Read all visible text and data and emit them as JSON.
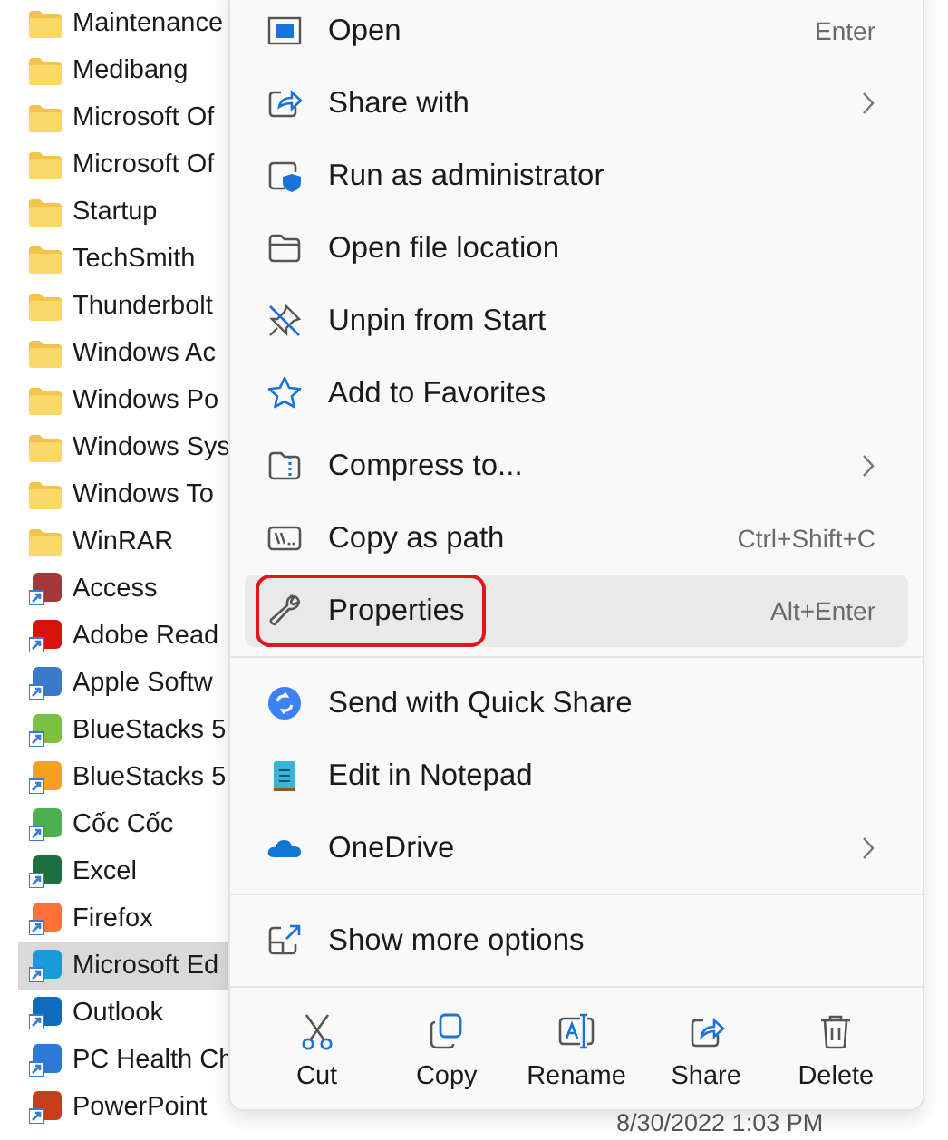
{
  "file_list": [
    {
      "name": "Maintenance",
      "kind": "folder",
      "selected": false
    },
    {
      "name": "Medibang",
      "kind": "folder",
      "selected": false
    },
    {
      "name": "Microsoft Of",
      "kind": "folder",
      "selected": false
    },
    {
      "name": "Microsoft Of",
      "kind": "folder",
      "selected": false
    },
    {
      "name": "Startup",
      "kind": "folder",
      "selected": false
    },
    {
      "name": "TechSmith",
      "kind": "folder",
      "selected": false
    },
    {
      "name": "Thunderbolt",
      "kind": "folder",
      "selected": false
    },
    {
      "name": "Windows Ac",
      "kind": "folder",
      "selected": false
    },
    {
      "name": "Windows Po",
      "kind": "folder",
      "selected": false
    },
    {
      "name": "Windows Sys",
      "kind": "folder",
      "selected": false
    },
    {
      "name": "Windows To",
      "kind": "folder",
      "selected": false
    },
    {
      "name": "WinRAR",
      "kind": "folder",
      "selected": false
    },
    {
      "name": "Access",
      "kind": "app",
      "color": "#a4373a",
      "selected": false
    },
    {
      "name": "Adobe Read",
      "kind": "app",
      "color": "#d7130c",
      "selected": false
    },
    {
      "name": "Apple Softw",
      "kind": "app",
      "color": "#3a78c9",
      "selected": false
    },
    {
      "name": "BlueStacks 5",
      "kind": "app",
      "color": "#7cc142",
      "selected": false
    },
    {
      "name": "BlueStacks 5",
      "kind": "app",
      "color": "#f4a020",
      "selected": false
    },
    {
      "name": "Cốc Cốc",
      "kind": "app",
      "color": "#4caf50",
      "selected": false
    },
    {
      "name": "Excel",
      "kind": "app",
      "color": "#1d6f42",
      "selected": false
    },
    {
      "name": "Firefox",
      "kind": "app",
      "color": "#ff7139",
      "selected": false
    },
    {
      "name": "Microsoft Ed",
      "kind": "app",
      "color": "#1a9bd7",
      "selected": true
    },
    {
      "name": "Outlook",
      "kind": "app",
      "color": "#0f6cbd",
      "selected": false
    },
    {
      "name": "PC Health Ch",
      "kind": "app",
      "color": "#2c7ad6",
      "selected": false
    },
    {
      "name": "PowerPoint",
      "kind": "app",
      "color": "#c43e1c",
      "selected": false
    }
  ],
  "date_text": "8/30/2022 1:03 PM",
  "context_menu": {
    "groups": [
      [
        {
          "label": "Open",
          "kind": "open",
          "shortcut": "Enter",
          "submenu": false,
          "selected": false,
          "marked": false
        },
        {
          "label": "Share with",
          "kind": "share",
          "submenu": true,
          "selected": false,
          "marked": false
        },
        {
          "label": "Run as administrator",
          "kind": "shield",
          "submenu": false,
          "selected": false,
          "marked": false
        },
        {
          "label": "Open file location",
          "kind": "folder",
          "submenu": false,
          "selected": false,
          "marked": false
        },
        {
          "label": "Unpin from Start",
          "kind": "unpin",
          "submenu": false,
          "selected": false,
          "marked": false
        },
        {
          "label": "Add to Favorites",
          "kind": "star",
          "submenu": false,
          "selected": false,
          "marked": false
        },
        {
          "label": "Compress to...",
          "kind": "zip",
          "submenu": true,
          "selected": false,
          "marked": false
        },
        {
          "label": "Copy as path",
          "kind": "path",
          "shortcut": "Ctrl+Shift+C",
          "submenu": false,
          "selected": false,
          "marked": false
        },
        {
          "label": "Properties",
          "kind": "wrench",
          "shortcut": "Alt+Enter",
          "submenu": false,
          "selected": true,
          "marked": true
        }
      ],
      [
        {
          "label": "Send with Quick Share",
          "kind": "quickshare",
          "submenu": false,
          "selected": false,
          "marked": false
        },
        {
          "label": "Edit in Notepad",
          "kind": "notepad",
          "submenu": false,
          "selected": false,
          "marked": false
        },
        {
          "label": "OneDrive",
          "kind": "cloud",
          "submenu": true,
          "selected": false,
          "marked": false
        }
      ],
      [
        {
          "label": "Show more options",
          "kind": "more",
          "submenu": false,
          "selected": false,
          "marked": false
        }
      ]
    ],
    "actions": [
      {
        "label": "Cut",
        "kind": "cut"
      },
      {
        "label": "Copy",
        "kind": "copy"
      },
      {
        "label": "Rename",
        "kind": "rename"
      },
      {
        "label": "Share",
        "kind": "share"
      },
      {
        "label": "Delete",
        "kind": "delete"
      }
    ]
  }
}
